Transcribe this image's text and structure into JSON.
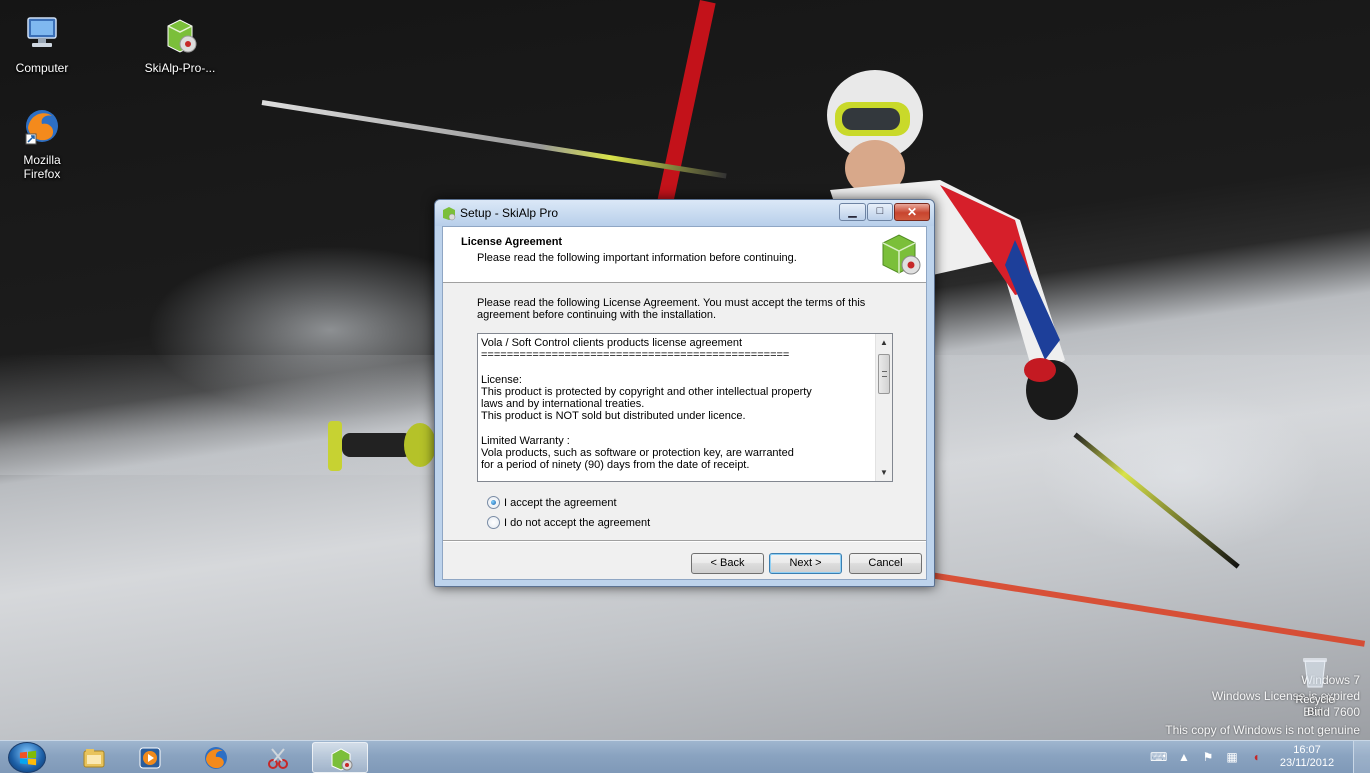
{
  "desktop": {
    "icons": [
      {
        "label": "Computer"
      },
      {
        "label": "SkiAlp-Pro-..."
      },
      {
        "label": "Mozilla Firefox"
      }
    ],
    "recycle_bin_label": "Recycle Bin",
    "watermark": {
      "line1": "Windows 7",
      "line2": "Windows License is expired",
      "line3": "Build 7600",
      "line4": "This copy of Windows is not genuine"
    }
  },
  "dialog": {
    "title": "Setup - SkiAlp Pro",
    "header_title": "License Agreement",
    "header_subtitle": "Please read the following important information before continuing.",
    "intro_text": "Please read the following License Agreement. You must accept the terms of this agreement before continuing with the installation.",
    "license_text": "Vola / Soft Control clients products license agreement\n================================================\n\nLicense:\nThis product is protected by copyright and other intellectual property\nlaws and by international treaties.\nThis product is NOT sold but distributed under licence.\n\nLimited Warranty :\nVola products, such as software or protection key, are warranted\nfor a period of ninety (90) days from the date of receipt.",
    "radio_accept": "I accept the agreement",
    "radio_decline": "I do not accept the agreement",
    "accept_selected": true,
    "buttons": {
      "back": "< Back",
      "next": "Next >",
      "cancel": "Cancel"
    }
  },
  "taskbar": {
    "clock_time": "16:07",
    "clock_date": "23/11/2012"
  },
  "colors": {
    "title_bar": "#bdd3ec",
    "close_button": "#c8452f",
    "taskbar": "#8aa3c0",
    "gate_pole": "#c3121a"
  }
}
